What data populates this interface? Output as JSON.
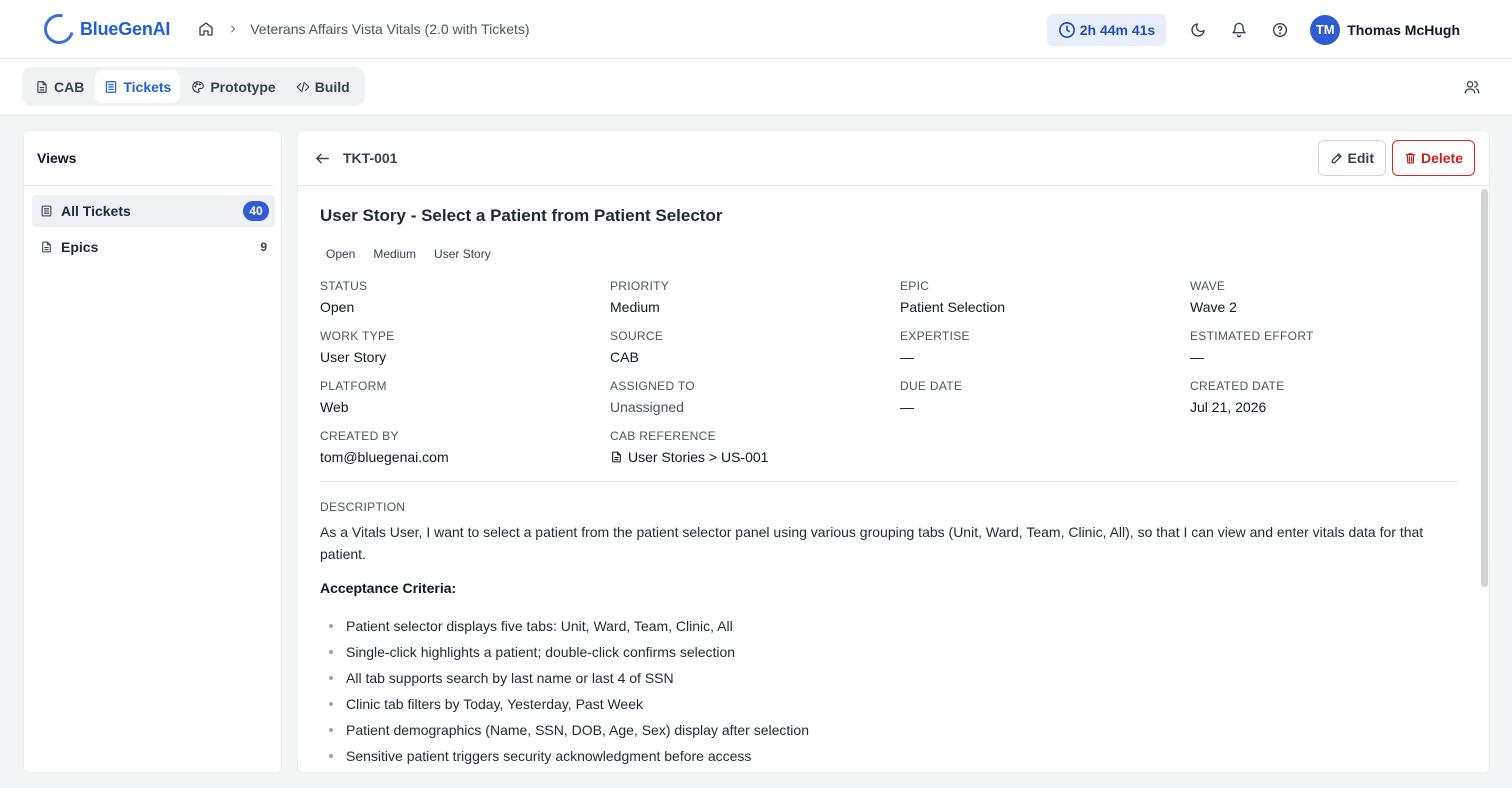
{
  "app": {
    "name": "BlueGenAI",
    "breadcrumb": {
      "project": "Veterans Affairs Vista Vitals (2.0 with Tickets)"
    },
    "timer": "2h 44m 41s",
    "user": {
      "initials": "TM",
      "name": "Thomas McHugh"
    }
  },
  "tabs": [
    {
      "label": "CAB",
      "icon": "document-icon"
    },
    {
      "label": "Tickets",
      "icon": "list-icon",
      "active": true
    },
    {
      "label": "Prototype",
      "icon": "palette-icon"
    },
    {
      "label": "Build",
      "icon": "code-icon"
    }
  ],
  "sidebar": {
    "title": "Views",
    "items": [
      {
        "label": "All Tickets",
        "count": "40",
        "active": true
      },
      {
        "label": "Epics",
        "count": "9"
      }
    ]
  },
  "ticket": {
    "id": "TKT-001",
    "edit_label": "Edit",
    "delete_label": "Delete",
    "title": "User Story - Select a Patient from Patient Selector",
    "tags": [
      "Open",
      "Medium",
      "User Story"
    ],
    "fields": {
      "status": {
        "label": "STATUS",
        "value": "Open"
      },
      "priority": {
        "label": "PRIORITY",
        "value": "Medium"
      },
      "epic": {
        "label": "EPIC",
        "value": "Patient Selection"
      },
      "wave": {
        "label": "WAVE",
        "value": "Wave 2"
      },
      "work_type": {
        "label": "WORK TYPE",
        "value": "User Story"
      },
      "source": {
        "label": "SOURCE",
        "value": "CAB"
      },
      "expertise": {
        "label": "EXPERTISE",
        "value": "—"
      },
      "estimated_effort": {
        "label": "ESTIMATED EFFORT",
        "value": "—"
      },
      "platform": {
        "label": "PLATFORM",
        "value": "Web"
      },
      "assigned_to": {
        "label": "ASSIGNED TO",
        "value": "Unassigned"
      },
      "due_date": {
        "label": "DUE DATE",
        "value": "—"
      },
      "created_date": {
        "label": "CREATED DATE",
        "value": "Jul 21, 2026"
      },
      "created_by": {
        "label": "CREATED BY",
        "value": "tom@bluegenai.com"
      },
      "cab_reference": {
        "label": "CAB REFERENCE",
        "value": "User Stories > US-001"
      }
    },
    "description_label": "DESCRIPTION",
    "description": "As a Vitals User, I want to select a patient from the patient selector panel using various grouping tabs (Unit, Ward, Team, Clinic, All), so that I can view and enter vitals data for that patient.",
    "acceptance_title": "Acceptance Criteria:",
    "acceptance_criteria": [
      "Patient selector displays five tabs: Unit, Ward, Team, Clinic, All",
      "Single-click highlights a patient; double-click confirms selection",
      "All tab supports search by last name or last 4 of SSN",
      "Clinic tab filters by Today, Yesterday, Past Week",
      "Patient demographics (Name, SSN, DOB, Age, Sex) display after selection",
      "Sensitive patient triggers security acknowledgment before access"
    ]
  },
  "colors": {
    "accent": "#2f5bd3",
    "brand": "#1f5fd1",
    "danger": "#dc2626"
  }
}
